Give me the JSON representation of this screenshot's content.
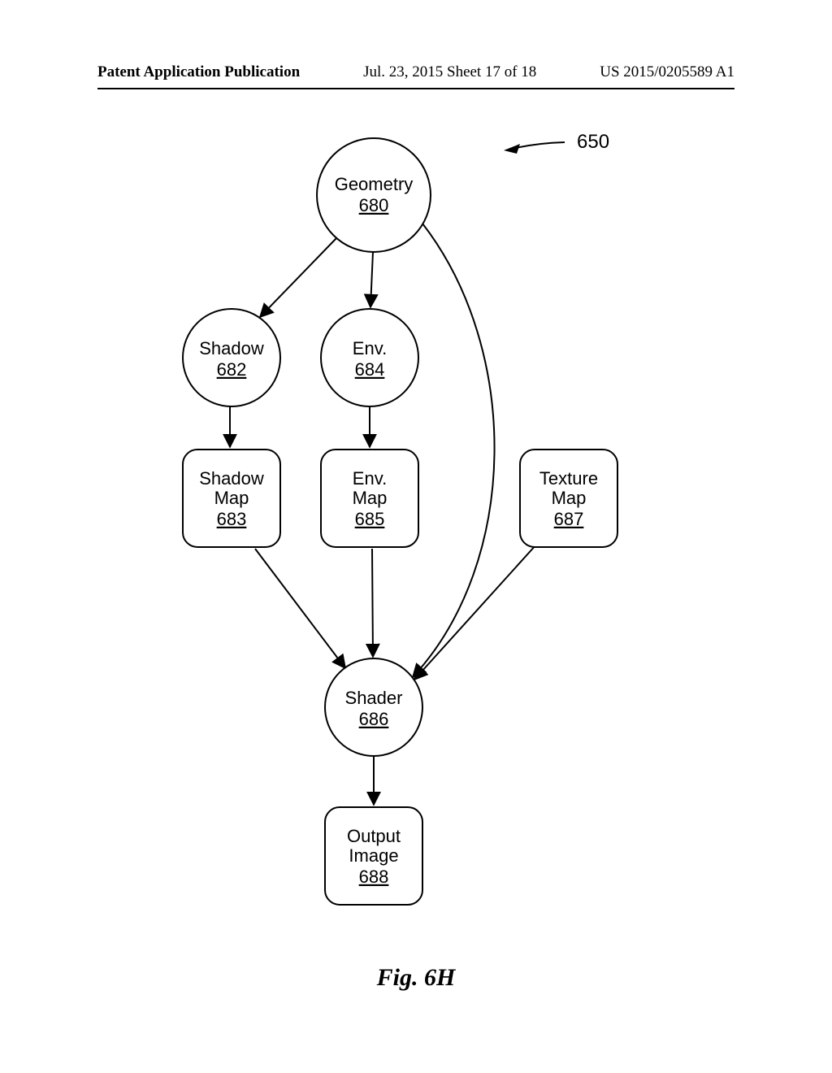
{
  "header": {
    "left": "Patent Application Publication",
    "mid": "Jul. 23, 2015   Sheet 17 of 18",
    "right": "US 2015/0205589 A1"
  },
  "callout": {
    "ref": "650"
  },
  "nodes": {
    "geometry": {
      "label": "Geometry",
      "ref": "680"
    },
    "shadow": {
      "label": "Shadow",
      "ref": "682"
    },
    "env": {
      "label": "Env.",
      "ref": "684"
    },
    "shadowmap": {
      "label1": "Shadow",
      "label2": "Map",
      "ref": "683"
    },
    "envmap": {
      "label1": "Env.",
      "label2": "Map",
      "ref": "685"
    },
    "texturemap": {
      "label1": "Texture",
      "label2": "Map",
      "ref": "687"
    },
    "shader": {
      "label": "Shader",
      "ref": "686"
    },
    "output": {
      "label1": "Output",
      "label2": "Image",
      "ref": "688"
    }
  },
  "caption": "Fig. 6H"
}
